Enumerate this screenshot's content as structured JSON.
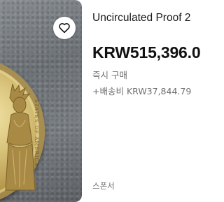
{
  "listing": {
    "title": "Uncirculated Proof 2",
    "price": "KRW515,396.0",
    "format": "즉시 구매",
    "shipping": "+배송비 KRW37,844.79",
    "sponsored": "스폰서"
  },
  "image": {
    "coin_inscription": "STATES OF AMERICA"
  },
  "icons": {
    "favorite": "heart-icon"
  },
  "colors": {
    "title_text": "#191919",
    "price_text": "#111111",
    "secondary_text": "#707070",
    "background": "#ffffff"
  }
}
